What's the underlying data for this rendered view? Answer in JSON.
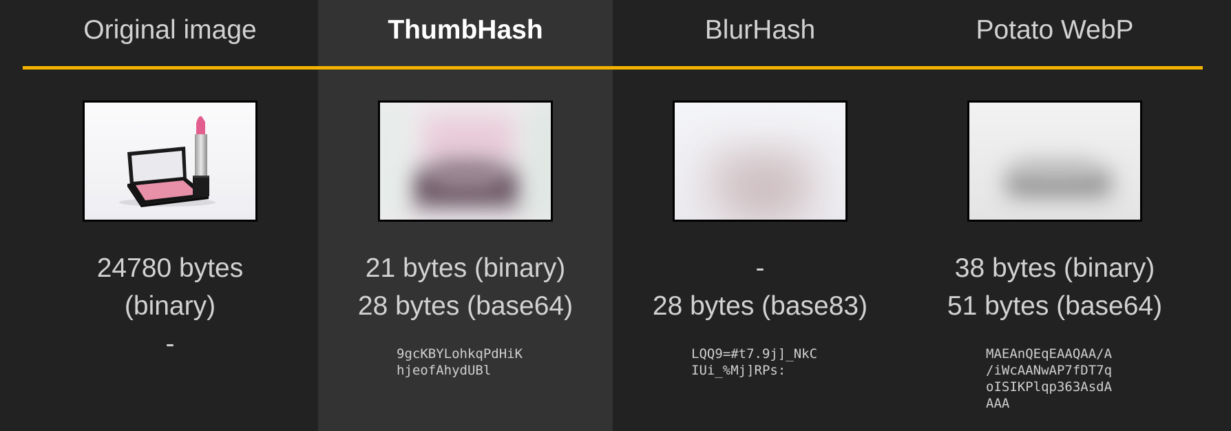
{
  "colors": {
    "background": "#222222",
    "highlight_column": "#333333",
    "accent_rule": "#f3b300",
    "text": "#d2d2d2"
  },
  "columns": [
    {
      "title": "Original image",
      "image_alt": "lipstick and compact",
      "size_line1": "24780 bytes",
      "size_line2": "(binary)",
      "size_line3": "-",
      "hash": ""
    },
    {
      "title": "ThumbHash",
      "image_alt": "",
      "size_line1": "21 bytes (binary)",
      "size_line2": "28 bytes (base64)",
      "size_line3": "",
      "hash": "9gcKBYLohkqPdHiK\nhjeofAhydUBl"
    },
    {
      "title": "BlurHash",
      "image_alt": "",
      "size_line1": "-",
      "size_line2": "28 bytes (base83)",
      "size_line3": "",
      "hash": "LQQ9=#t7.9j]_NkC\nIUi_%Mj]RPs:"
    },
    {
      "title": "Potato WebP",
      "image_alt": "",
      "size_line1": "38 bytes (binary)",
      "size_line2": "51 bytes (base64)",
      "size_line3": "",
      "hash": "MAEAnQEqEAAQAA/A\n/iWcAANwAP7fDT7q\noISIKPlqp363AsdA\nAAA"
    }
  ]
}
